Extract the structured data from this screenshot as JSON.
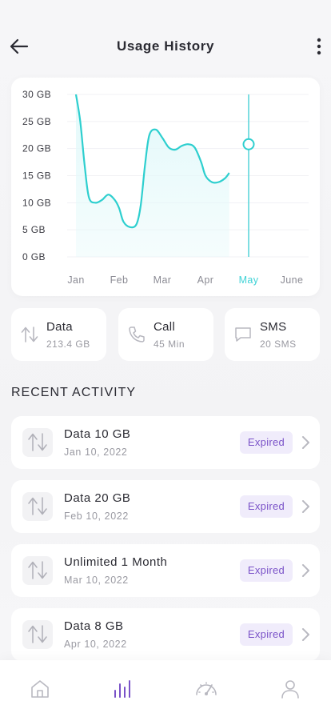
{
  "header": {
    "title": "Usage History",
    "back_icon": "arrow-left-icon",
    "more_icon": "more-vertical-icon"
  },
  "chart_data": {
    "type": "area",
    "y_ticks": [
      "30 GB",
      "25 GB",
      "20 GB",
      "15 GB",
      "10 GB",
      "5 GB",
      "0 GB"
    ],
    "ylim": [
      0,
      30
    ],
    "categories": [
      "Jan",
      "Feb",
      "Mar",
      "Apr",
      "May",
      "June"
    ],
    "selected_category": "May",
    "x": [
      0,
      0.1,
      0.15,
      0.25,
      0.35,
      0.45,
      0.55,
      0.62,
      0.75,
      0.85,
      0.9,
      1.0,
      1.1,
      1.25,
      1.4,
      1.5,
      1.6,
      1.75,
      1.85,
      2.0,
      2.15,
      2.25,
      2.35,
      2.5,
      2.6,
      2.75,
      2.9,
      3.0,
      3.1,
      3.25,
      3.4,
      3.5,
      3.6,
      3.75,
      3.9,
      4.0,
      4.1,
      4.25,
      4.4,
      4.5,
      4.6,
      4.75,
      4.9,
      5.0
    ],
    "values": [
      30,
      25,
      22,
      15,
      11,
      10,
      10,
      11,
      11.5,
      10.5,
      9,
      6.5,
      5.5,
      5.5,
      9,
      15,
      22,
      23.5,
      23,
      20.5,
      19.8,
      20,
      20.5,
      20.8,
      20.5,
      19.5,
      17,
      15,
      14,
      13.7,
      14,
      15.5
    ],
    "series_points": [
      [
        0,
        30
      ],
      [
        0.1,
        25
      ],
      [
        0.2,
        17
      ],
      [
        0.3,
        11
      ],
      [
        0.45,
        10
      ],
      [
        0.6,
        10.5
      ],
      [
        0.75,
        11.5
      ],
      [
        0.9,
        10.5
      ],
      [
        1.0,
        9
      ],
      [
        1.1,
        6.5
      ],
      [
        1.25,
        5.5
      ],
      [
        1.4,
        6
      ],
      [
        1.5,
        9.5
      ],
      [
        1.6,
        17
      ],
      [
        1.7,
        22.5
      ],
      [
        1.85,
        23.5
      ],
      [
        2.0,
        22
      ],
      [
        2.15,
        20.2
      ],
      [
        2.3,
        19.8
      ],
      [
        2.45,
        20.5
      ],
      [
        2.6,
        20.8
      ],
      [
        2.75,
        20.2
      ],
      [
        2.9,
        17.5
      ],
      [
        3.0,
        15
      ],
      [
        3.15,
        13.8
      ],
      [
        3.3,
        13.8
      ],
      [
        3.45,
        14.5
      ],
      [
        3.55,
        15.5
      ]
    ],
    "marker": {
      "category": "May",
      "value": 20.8
    },
    "colors": {
      "line": "#2ecfcf",
      "fill": "#e3f9fa",
      "marker_line": "#5fd6da",
      "grid": "#f1f1f4"
    }
  },
  "stats": [
    {
      "label": "Data",
      "value": "213.4 GB",
      "icon": "data-transfer-icon"
    },
    {
      "label": "Call",
      "value": "45 Min",
      "icon": "phone-icon"
    },
    {
      "label": "SMS",
      "value": "20 SMS",
      "icon": "message-icon"
    }
  ],
  "recent": {
    "title": "RECENT ACTIVITY",
    "items": [
      {
        "name": "Data 10 GB",
        "date": "Jan 10, 2022",
        "status": "Expired"
      },
      {
        "name": "Data 20 GB",
        "date": "Feb 10, 2022",
        "status": "Expired"
      },
      {
        "name": "Unlimited 1 Month",
        "date": "Mar 10, 2022",
        "status": "Expired"
      },
      {
        "name": "Data 8 GB",
        "date": "Apr 10, 2022",
        "status": "Expired"
      }
    ]
  },
  "tabs": [
    {
      "name": "home-icon",
      "active": false
    },
    {
      "name": "bar-chart-icon",
      "active": true
    },
    {
      "name": "speedometer-icon",
      "active": false
    },
    {
      "name": "user-icon",
      "active": false
    }
  ],
  "colors": {
    "accent": "#7a52c8",
    "teal": "#2ecfcf",
    "badge_bg": "#f0ecfb",
    "muted": "#9a9aa2"
  }
}
